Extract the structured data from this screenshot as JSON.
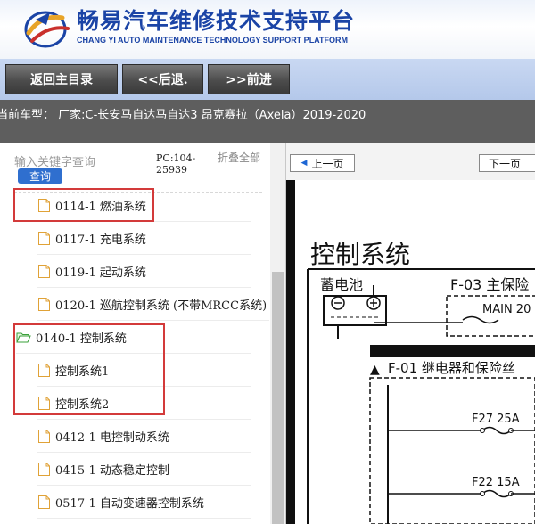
{
  "header": {
    "title": "畅易汽车维修技术支持平台",
    "subtitle": "CHANG YI AUTO MAINTENANCE TECHNOLOGY SUPPORT PLATFORM"
  },
  "toolbar": {
    "home_label": "返回主目录",
    "back_label": "<<后退.",
    "forward_label": ">>前进"
  },
  "model_bar": {
    "text": "当前车型： 厂家:C-长安马自达马自达3 昂克赛拉（Axela）2019-2020"
  },
  "left_panel": {
    "search_placeholder": "输入关键字查询",
    "search_button": "查询",
    "pc_code": "PC:104-25939",
    "collapse_all": "折叠全部"
  },
  "tree": {
    "items": [
      {
        "label": "0114-1 燃油系统",
        "type": "file",
        "highlighted": true
      },
      {
        "label": "0117-1 充电系统",
        "type": "file"
      },
      {
        "label": "0119-1 起动系统",
        "type": "file"
      },
      {
        "label": "0120-1 巡航控制系统 (不带MRCC系统)",
        "type": "file"
      },
      {
        "label": "0140-1 控制系统",
        "type": "folder-open",
        "highlighted": true
      },
      {
        "label": "控制系统1",
        "type": "file",
        "highlighted": true
      },
      {
        "label": "控制系统2",
        "type": "file",
        "highlighted": true
      },
      {
        "label": "0412-1 电控制动系统",
        "type": "file"
      },
      {
        "label": "0415-1 动态稳定控制",
        "type": "file"
      },
      {
        "label": "0517-1 自动变速器控制系统",
        "type": "file"
      }
    ]
  },
  "doc_viewer": {
    "prev_label": "上一页",
    "next_label": "下一页",
    "diagram": {
      "title": "控制系统",
      "battery_label": "蓄电池",
      "fuse_block_label": "F-03 主保险",
      "main_fuse_label": "MAIN 20",
      "relay_block_label": "F-01 继电器和保险丝",
      "fuse_1_label": "F27 25A",
      "fuse_2_label": "F22 15A"
    }
  },
  "colors": {
    "brand_blue": "#1b44a6",
    "toolbar_bg": "#b4c8ea",
    "button_dark": "#4c4c4c",
    "model_bar_bg": "#5e5e5e",
    "search_button_bg": "#2f6fcf",
    "highlight_red": "#d33a3a",
    "folder_green": "#3aa03a"
  },
  "icons": {
    "logo": "cy-logo-icon",
    "file": "file-icon",
    "folder_open": "folder-open-icon",
    "prev_arrow": "triangle-left-icon"
  }
}
